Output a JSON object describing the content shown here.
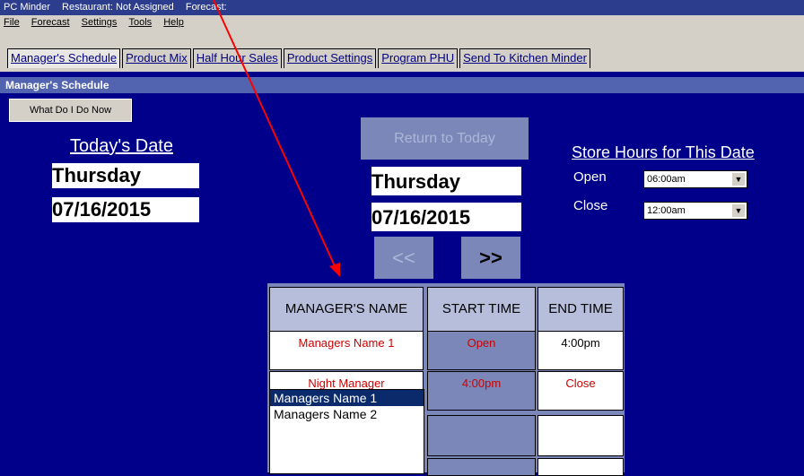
{
  "titlebar": {
    "app": "PC Minder",
    "restaurant": "Restaurant: Not Assigned",
    "forecast": "Forecast:"
  },
  "menu": {
    "items": [
      "File",
      "Forecast",
      "Settings",
      "Tools",
      "Help"
    ]
  },
  "tabs": [
    {
      "label": "Manager's Schedule",
      "active": true
    },
    {
      "label": "Product Mix"
    },
    {
      "label": "Half Hour Sales"
    },
    {
      "label": "Product Settings"
    },
    {
      "label": "Program PHU"
    },
    {
      "label": "Send To Kitchen Minder"
    }
  ],
  "panel": {
    "title": "Manager's Schedule"
  },
  "buttons": {
    "what_do_i_do_now": "What Do I Do Now",
    "return_to_today": "Return to Today",
    "prev": "<<",
    "next": ">>"
  },
  "today": {
    "label": "Today's Date",
    "day": "Thursday",
    "date": "07/16/2015"
  },
  "selected": {
    "day": "Thursday",
    "date": "07/16/2015"
  },
  "store_hours": {
    "label": "Store Hours for This Date",
    "open_label": "Open",
    "close_label": "Close",
    "open_value": "06:00am",
    "close_value": "12:00am"
  },
  "schedule": {
    "headers": [
      "MANAGER'S NAME",
      "START TIME",
      "END TIME"
    ],
    "rows": [
      {
        "name": "Managers Name 1",
        "start": "Open",
        "end": "4:00pm"
      },
      {
        "name": "Night Manager",
        "start": "4:00pm",
        "end": "Close"
      },
      {
        "name": "",
        "start": "",
        "end": ""
      },
      {
        "name": "",
        "start": "",
        "end": ""
      }
    ]
  },
  "dropdown": {
    "options": [
      "Managers Name 1",
      "Managers Name 2"
    ],
    "selected_index": 0
  },
  "colors": {
    "background": "#00008b",
    "accent": "#7b87b8",
    "red_text": "#cc0000",
    "arrow": "#ff0000"
  }
}
